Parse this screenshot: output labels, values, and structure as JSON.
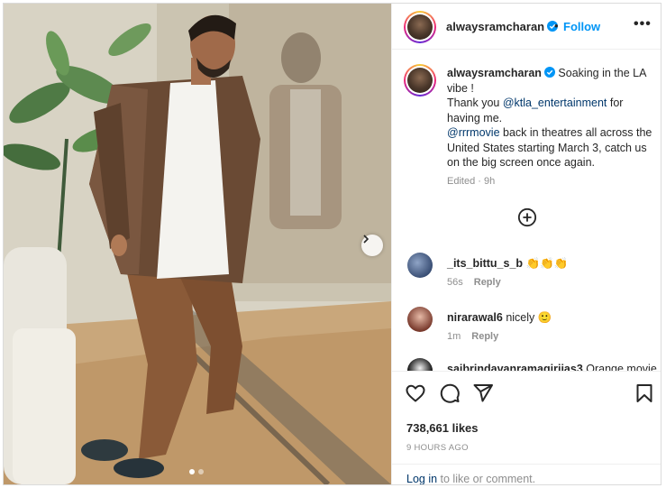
{
  "post": {
    "username": "alwaysramcharan",
    "follow_label": "Follow",
    "separator": "•",
    "more_label": "•••",
    "caption_user": "alwaysramcharan",
    "caption_line1": "Soaking in the LA vibe !",
    "caption_line2_pre": "Thank you ",
    "caption_mention1": "@ktla_entertainment",
    "caption_line2_post": " for having me.",
    "caption_mention2": "@rrrmovie",
    "caption_line3_post": " back in theatres all across the United States starting March 3, catch us on the big screen once again.",
    "edited": "Edited",
    "edited_sep": "·",
    "caption_time": "9h",
    "slide_count": 2,
    "active_slide": 1
  },
  "comments": [
    {
      "user": "_its_bittu_s_b",
      "text": "👏👏👏",
      "time": "56s",
      "reply": "Reply"
    },
    {
      "user": "nirarawal6",
      "text": "nicely 🙂",
      "time": "1m",
      "reply": "Reply"
    },
    {
      "user": "saibrindavanramagiriias3",
      "text": "Orange movie",
      "time": "",
      "reply": ""
    }
  ],
  "footer": {
    "likes": "738,661 likes",
    "timestamp": "9 HOURS AGO",
    "login_link": "Log in",
    "login_text": " to like or comment."
  },
  "icons": {
    "like": "heart-icon",
    "comment": "comment-bubble-icon",
    "share": "paper-plane-icon",
    "save": "bookmark-icon",
    "more": "more-dots-icon",
    "verified": "verified-badge-icon",
    "next": "chevron-right-icon",
    "load_more": "plus-circle-icon"
  },
  "colors": {
    "accent": "#0095f6",
    "link": "#00376b",
    "muted": "#8e8e8e",
    "text": "#262626",
    "border": "#efefef"
  }
}
